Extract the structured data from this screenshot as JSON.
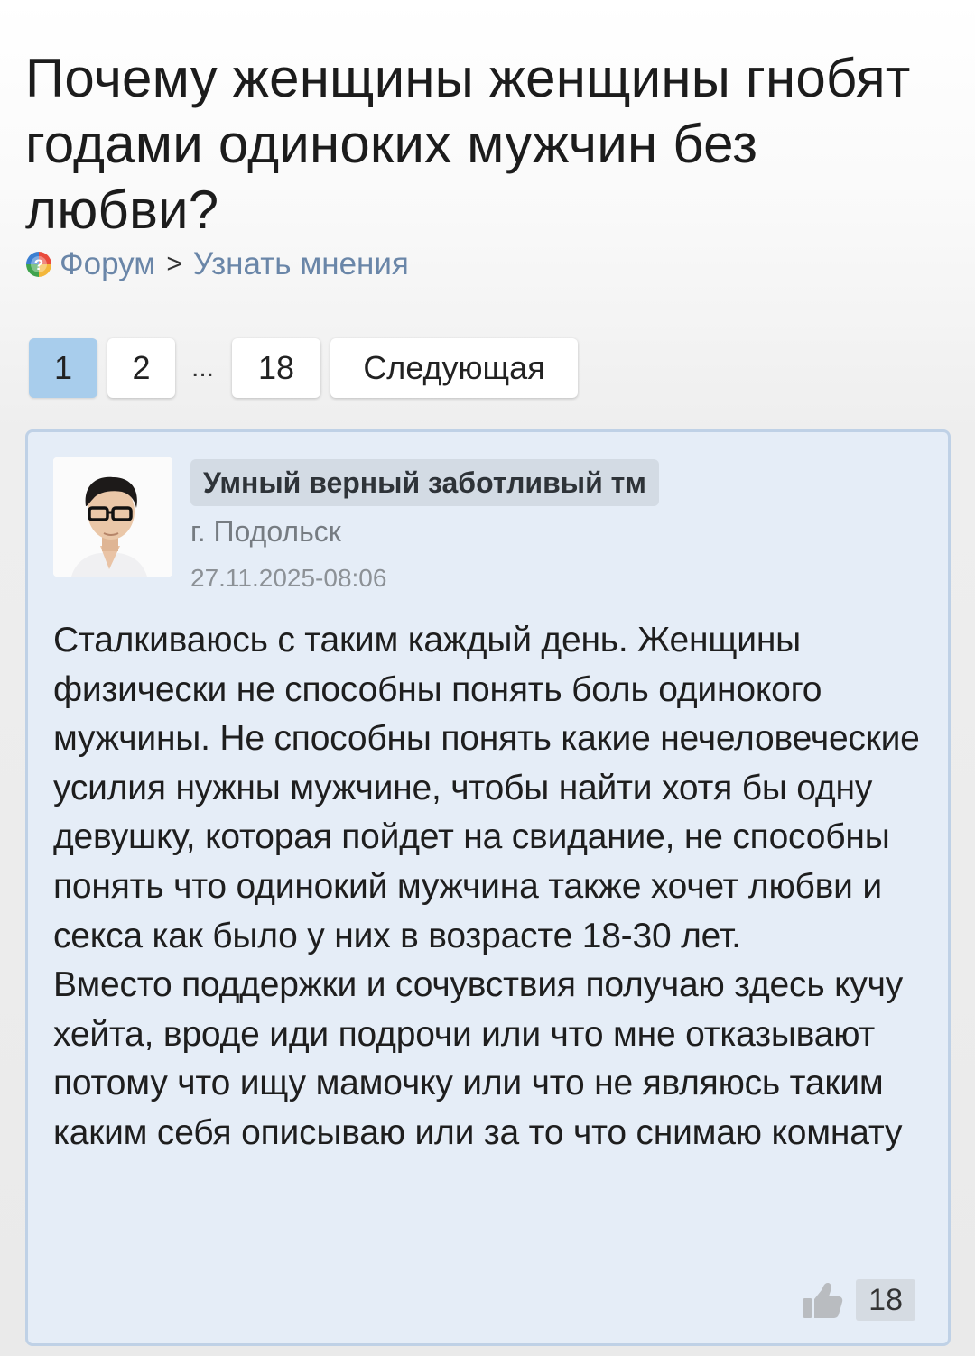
{
  "topic": {
    "title": "Почему женщины женщины гнобят годами одиноких мужчин без любви?"
  },
  "breadcrumb": {
    "items": [
      "Форум",
      "Узнать мнения"
    ],
    "separator": ">"
  },
  "pagination": {
    "pages": [
      "1",
      "2",
      "18"
    ],
    "ellipsis": "...",
    "current": "1",
    "next_label": "Следующая"
  },
  "post": {
    "author": {
      "name": "Умный верный заботливый тм",
      "city": "г. Подольск"
    },
    "date": "27.11.2025-08:06",
    "paragraphs": [
      "Сталкиваюсь с таким каждый день. Женщины физически не способны понять боль одинокого мужчины. Не способны понять какие нечеловеческие усилия нужны мужчине, чтобы найти хотя бы одну девушку, которая пойдет на свидание, не способны понять что одинокий мужчина также хочет любви и секса как было у них в возрасте 18-30 лет.",
      "Вместо поддержки и сочувствия получаю здесь кучу хейта, вроде иди подрочи или что мне отказывают потому что ищу мамочку или что не являюсь таким каким себя описываю или за то что снимаю комнату"
    ],
    "likes": "18"
  },
  "colors": {
    "link": "#6a86a8",
    "active_page": "#a8cdec",
    "post_background": "#e5edf7",
    "post_border": "#bfd1e6",
    "author_badge": "#d3dbe4"
  },
  "icons": {
    "breadcrumb": "question-circle-icon",
    "like": "thumbs-up-icon"
  }
}
